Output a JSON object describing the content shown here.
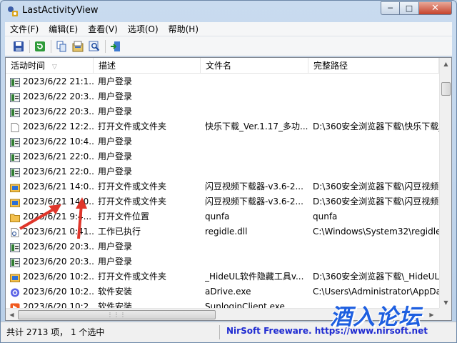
{
  "window": {
    "title": "LastActivityView",
    "buttons": {
      "minimize": "─",
      "maximize": "□",
      "close": "✕"
    }
  },
  "menu": [
    "文件(F)",
    "编辑(E)",
    "查看(V)",
    "选项(O)",
    "帮助(H)"
  ],
  "toolbar": {
    "icons": [
      "save-icon",
      "refresh-icon",
      "copy-icon",
      "properties-icon",
      "find-icon",
      "exit-icon"
    ]
  },
  "table": {
    "columns": [
      "活动时间",
      "描述",
      "文件名",
      "完整路径"
    ],
    "sort_indicator": "▽",
    "rows": [
      {
        "time": "2023/6/22 21:1...",
        "desc": "用户登录",
        "file": "",
        "path": "",
        "icon": "login-icon"
      },
      {
        "time": "2023/6/22 20:3...",
        "desc": "用户登录",
        "file": "",
        "path": "",
        "icon": "login-icon"
      },
      {
        "time": "2023/6/22 20:3...",
        "desc": "用户登录",
        "file": "",
        "path": "",
        "icon": "login-icon"
      },
      {
        "time": "2023/6/22 12:2...",
        "desc": "打开文件或文件夹",
        "file": "快乐下载_Ver.1.17_多功...",
        "path": "D:\\360安全浏览器下载\\快乐下载_",
        "icon": "file-icon"
      },
      {
        "time": "2023/6/22 10:4...",
        "desc": "用户登录",
        "file": "",
        "path": "",
        "icon": "login-icon"
      },
      {
        "time": "2023/6/21 22:0...",
        "desc": "用户登录",
        "file": "",
        "path": "",
        "icon": "login-icon"
      },
      {
        "time": "2023/6/21 22:0...",
        "desc": "用户登录",
        "file": "",
        "path": "",
        "icon": "login-icon"
      },
      {
        "time": "2023/6/21 14:0...",
        "desc": "打开文件或文件夹",
        "file": "闪豆视频下载器-v3.6-2...",
        "path": "D:\\360安全浏览器下载\\闪豆视频下",
        "icon": "folder-app-icon"
      },
      {
        "time": "2023/6/21 14:0...",
        "desc": "打开文件或文件夹",
        "file": "闪豆视频下载器-v3.6-2...",
        "path": "D:\\360安全浏览器下载\\闪豆视频下",
        "icon": "folder-app-icon"
      },
      {
        "time": "2023/6/21 9:4...",
        "desc": "打开文件位置",
        "file": "qunfa",
        "path": "qunfa",
        "icon": "folder-icon"
      },
      {
        "time": "2023/6/21 0:41...",
        "desc": "工作已执行",
        "file": "regidle.dll",
        "path": "C:\\Windows\\System32\\regidle.",
        "icon": "dll-icon"
      },
      {
        "time": "2023/6/20 20:3...",
        "desc": "用户登录",
        "file": "",
        "path": "",
        "icon": "login-icon"
      },
      {
        "time": "2023/6/20 20:3...",
        "desc": "用户登录",
        "file": "",
        "path": "",
        "icon": "login-icon"
      },
      {
        "time": "2023/6/20 10:2...",
        "desc": "打开文件或文件夹",
        "file": "_HideUL软件隐藏工具v...",
        "path": "D:\\360安全浏览器下载\\_HideUL软",
        "icon": "folder-app-icon"
      },
      {
        "time": "2023/6/20 10:2...",
        "desc": "软件安装",
        "file": "aDrive.exe",
        "path": "C:\\Users\\Administrator\\AppDat",
        "icon": "adrive-icon"
      },
      {
        "time": "2023/6/20 10:2...",
        "desc": "软件安装",
        "file": "SunloginClient.exe",
        "path": "",
        "icon": "sunlogin-icon"
      }
    ]
  },
  "status": {
    "summary": "共计 2713 项， 1 个选中",
    "link": "NirSoft Freeware. https://www.nirsoft.net"
  },
  "watermark": "酒入论坛",
  "colors": {
    "link": "#1f2bd1",
    "watermark": "#1e5fe0",
    "annotation": "#e0362b"
  }
}
